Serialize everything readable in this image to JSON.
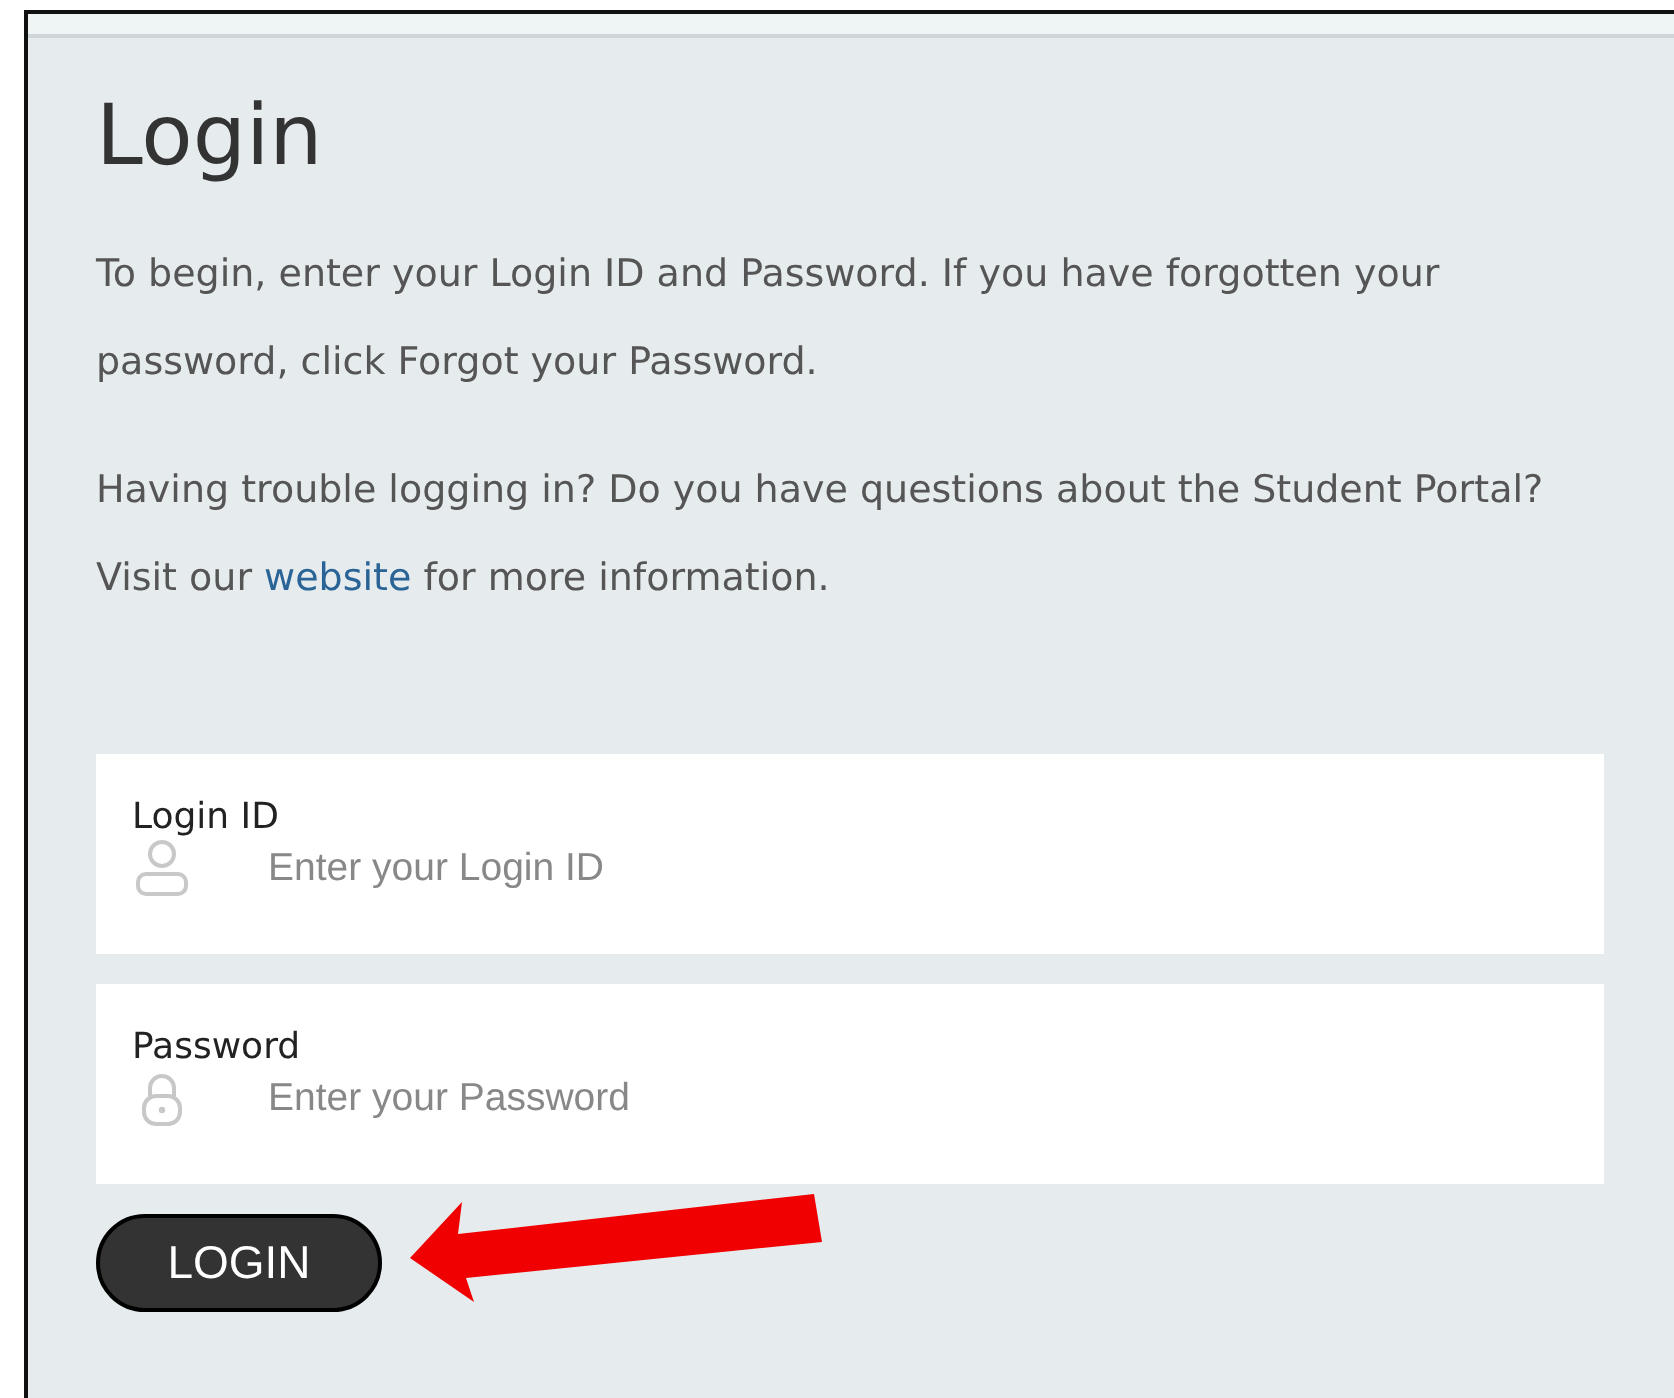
{
  "heading": "Login",
  "intro": "To begin, enter your Login ID and Password. If you have forgotten your password, click Forgot your Password.",
  "help": {
    "before": "Having trouble logging in? Do you have questions about the Student Portal? Visit our",
    "link": "website",
    "after": "for more information."
  },
  "fields": [
    {
      "label": "Login ID",
      "placeholder": "Enter your Login ID",
      "kind": "user"
    },
    {
      "label": "Password",
      "placeholder": "Enter your Password",
      "kind": "lock"
    }
  ],
  "button": "LOGIN"
}
